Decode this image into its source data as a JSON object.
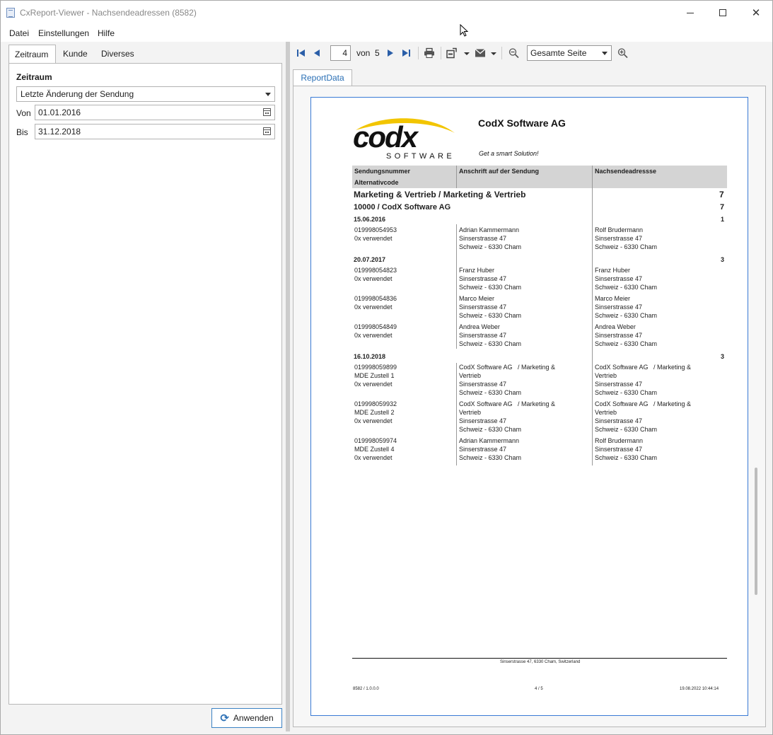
{
  "window": {
    "title": "CxReport-Viewer - Nachsendeadressen (8582)"
  },
  "menu": [
    "Datei",
    "Einstellungen",
    "Hilfe"
  ],
  "left_tabs": [
    "Zeitraum",
    "Kunde",
    "Diverses"
  ],
  "filter": {
    "section_title": "Zeitraum",
    "mode_value": "Letzte Änderung der Sendung",
    "from_label": "Von",
    "from_value": "01.01.2016",
    "to_label": "Bis",
    "to_value": "31.12.2018"
  },
  "apply_label": "Anwenden",
  "toolbar": {
    "page_current": "4",
    "of_label": "von",
    "page_total": "5",
    "zoom_value": "Gesamte Seite"
  },
  "report_tab": "ReportData",
  "report": {
    "logo_text": "codx",
    "logo_sub": "SOFTWARE",
    "company": "CodX Software AG",
    "slogan": "Get a smart Solution!",
    "columns": [
      "Sendungsnummer",
      "Anschrift auf der Sendung",
      "Nachsendeadressse"
    ],
    "subcolumn": "Alternativcode",
    "group1": {
      "label": "Marketing & Vertrieb / Marketing & Vertrieb",
      "count": "7"
    },
    "group2": {
      "label": "10000 / CodX Software AG",
      "count": "7"
    },
    "date_groups": [
      {
        "date": "15.06.2016",
        "count": "1"
      },
      {
        "date": "20.07.2017",
        "count": "3"
      },
      {
        "date": "16.10.2018",
        "count": "3"
      }
    ],
    "rows": [
      {
        "nr": "019998054953\n0x verwendet",
        "addr": "Adrian Kammermann\nSinserstrasse 47\nSchweiz - 6330 Cham",
        "fwd": "Rolf Brudermann\nSinserstrasse 47\nSchweiz - 6330 Cham"
      },
      {
        "nr": "019998054823\n0x verwendet",
        "addr": "Franz Huber\nSinserstrasse 47\nSchweiz - 6330 Cham",
        "fwd": "Franz Huber\nSinserstrasse 47\nSchweiz - 6330 Cham"
      },
      {
        "nr": "019998054836\n0x verwendet",
        "addr": "Marco Meier\nSinserstrasse 47\nSchweiz - 6330 Cham",
        "fwd": "Marco Meier\nSinserstrasse 47\nSchweiz - 6330 Cham"
      },
      {
        "nr": "019998054849\n0x verwendet",
        "addr": "Andrea Weber\nSinserstrasse 47\nSchweiz - 6330 Cham",
        "fwd": "Andrea Weber\nSinserstrasse 47\nSchweiz - 6330 Cham"
      },
      {
        "nr": "019998059899\nMDE Zustell 1\n0x verwendet",
        "addr": "CodX Software AG   / Marketing &\nVertrieb\nSinserstrasse 47\nSchweiz - 6330 Cham",
        "fwd": "CodX Software AG   / Marketing &\nVertrieb\nSinserstrasse 47\nSchweiz - 6330 Cham"
      },
      {
        "nr": "019998059932\nMDE Zustell 2\n0x verwendet",
        "addr": "CodX Software AG   / Marketing &\nVertrieb\nSinserstrasse 47\nSchweiz - 6330 Cham",
        "fwd": "CodX Software AG   / Marketing &\nVertrieb\nSinserstrasse 47\nSchweiz - 6330 Cham"
      },
      {
        "nr": "019998059974\nMDE Zustell 4\n0x verwendet",
        "addr": "Adrian Kammermann\nSinserstrasse 47\nSchweiz - 6330 Cham",
        "fwd": "Rolf Brudermann\nSinserstrasse 47\nSchweiz - 6330 Cham"
      }
    ],
    "footer_address": "Sinserstrasse 47, 6330 Cham, Switzerland",
    "footer_version": "8582 / 1.0.0.0",
    "footer_page": "4 / 5",
    "footer_timestamp": "19.08.2022 10:44:14"
  },
  "colors": {
    "accent": "#2a6fb5",
    "page_border": "#3a7bd5",
    "logo_yellow": "#f2c500"
  }
}
